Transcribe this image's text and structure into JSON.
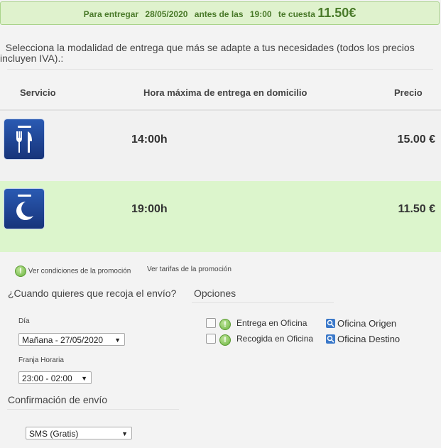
{
  "banner": {
    "prefix": "Para entregar",
    "date": "28/05/2020",
    "middle": "antes de las",
    "time": "19:00",
    "suffix": "te cuesta",
    "price": "11.50€"
  },
  "intro": "Selecciona la modalidad de entrega que más se adapte a tus necesidades (todos los precios incluyen IVA).:",
  "table": {
    "headers": [
      "Servicio",
      "Hora máxima de entrega en domicilio",
      "Precio"
    ],
    "rows": [
      {
        "icon": "fork-knife-icon",
        "time": "14:00h",
        "price": "15.00 €"
      },
      {
        "icon": "moon-icon",
        "time": "19:00h",
        "price": "11.50 €"
      }
    ]
  },
  "promo": {
    "conditions": "Ver condiciones de la promoción",
    "rates": "Ver tarifas de la promoción"
  },
  "pickup": {
    "title": "¿Cuando quieres que recoja el envío?",
    "day_label": "Día",
    "day_value": "Mañana - 27/05/2020",
    "slot_label": "Franja Horaria",
    "slot_value": "23:00 - 02:00"
  },
  "options": {
    "title": "Opciones",
    "items": [
      {
        "label": "Entrega en Oficina",
        "link": "Oficina Origen"
      },
      {
        "label": "Recogida en Oficina",
        "link": "Oficina Destino"
      }
    ]
  },
  "confirmation": {
    "title": "Confirmación de envío",
    "value": "SMS (Gratis)"
  },
  "colors": {
    "banner_bg": "#dff2cd",
    "selected_row": "#dcf5cc",
    "icon_blue": "#1f4596"
  }
}
